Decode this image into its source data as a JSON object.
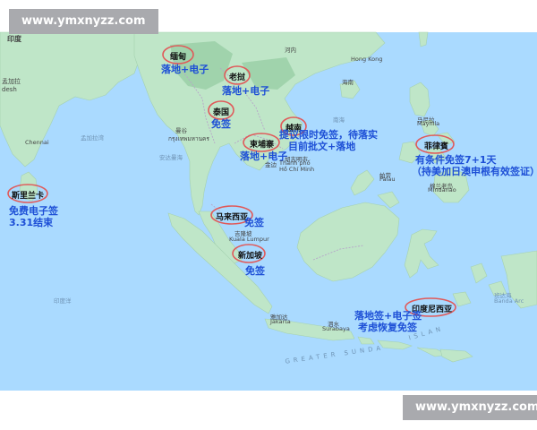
{
  "watermark": {
    "top": "www.ymxnyzz.com",
    "bottom": "www.ymxnyzz.com"
  },
  "corner_label": "印度",
  "countries": [
    {
      "id": "myanmar",
      "name": "缅甸",
      "note": "落地+电子"
    },
    {
      "id": "laos",
      "name": "老挝",
      "note": "落地+电子"
    },
    {
      "id": "thailand",
      "name": "泰国",
      "note": "免签"
    },
    {
      "id": "vietnam",
      "name": "越南",
      "note_lines": [
        "提议限时免签，待落实",
        "目前批文+落地"
      ]
    },
    {
      "id": "cambodia",
      "name": "柬埔寨",
      "note": "落地+电子"
    },
    {
      "id": "philippines",
      "name": "菲律賓",
      "note_lines": [
        "有条件免签7+1天",
        "（持美加日澳申根有效签证）"
      ]
    },
    {
      "id": "srilanka",
      "name": "斯里兰卡",
      "note_lines": [
        "免费电子签",
        "3.31结束"
      ]
    },
    {
      "id": "malaysia",
      "name": "马来西亚",
      "note": "免签"
    },
    {
      "id": "singapore",
      "name": "新加坡",
      "note": "免签"
    },
    {
      "id": "indonesia",
      "name": "印度尼西亚",
      "note_lines": [
        "落地签+电子签",
        "考虑恢复免签"
      ]
    }
  ],
  "places": {
    "hanoi": "河内",
    "hainan": "海南",
    "hong_kong": "Hong Kong",
    "dhaka": "Dhaka",
    "bangladesh": "孟加拉",
    "desh": "desh",
    "chennai": "Chennai",
    "bengal_bay": "孟加拉湾",
    "andaman": "安达曼海",
    "bangkok_thai": "กรุงเทพมหานคร",
    "bangkok": "曼谷",
    "phnom_penh": "金边",
    "ho_chi_minh_cn": "胡志明市",
    "ho_chi_minh_vn": "Thành phố",
    "ho_chi_minh_en": "Hồ Chí Minh",
    "south_china_sea": "南海",
    "manila": "马尼拉",
    "maynila": "Maynila",
    "palau": "帕劳",
    "palau_en": "Palau",
    "mindanao": "棉兰老岛",
    "mindanao_en": "Mindanao",
    "kuala_lumpur_cn": "吉隆坡",
    "kuala_lumpur": "Kuala Lumpur",
    "jakarta_cn": "雅加达",
    "jakarta": "Jakarta",
    "surabaya_cn": "泗水",
    "surabaya": "Surabaya",
    "banda_sea": "班达海",
    "banda_arc": "Banda Arc",
    "greater_sunda": "GREATER SUNDA",
    "islands": "ISLAN",
    "india_ocean": "印度洋"
  }
}
